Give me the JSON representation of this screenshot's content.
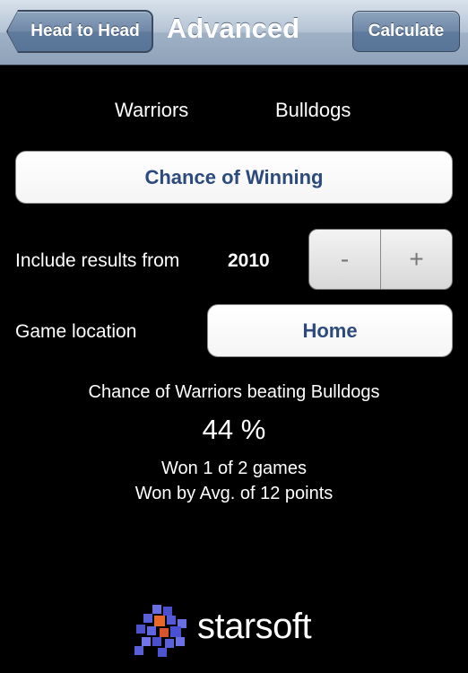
{
  "nav": {
    "back_label": "Head to Head",
    "title": "Advanced",
    "calculate_label": "Calculate"
  },
  "teams": {
    "team_a": "Warriors",
    "team_b": "Bulldogs"
  },
  "mode_button_label": "Chance of Winning",
  "include_results": {
    "label": "Include results from",
    "year": "2010",
    "decrement_label": "-",
    "increment_label": "+"
  },
  "game_location": {
    "label": "Game location",
    "value": "Home"
  },
  "result": {
    "heading": "Chance of Warriors beating Bulldogs",
    "percentage": "44 %",
    "games": "Won 1 of 2 games",
    "average": "Won by Avg. of 12 points"
  },
  "brand": {
    "name": "starsoft",
    "logo_icon": "starsoft-logo-icon"
  },
  "colors": {
    "navbar": "#9fb1c5",
    "nav_button": "#6f88a7",
    "button_text": "#2d4a7c",
    "background": "#000000"
  }
}
